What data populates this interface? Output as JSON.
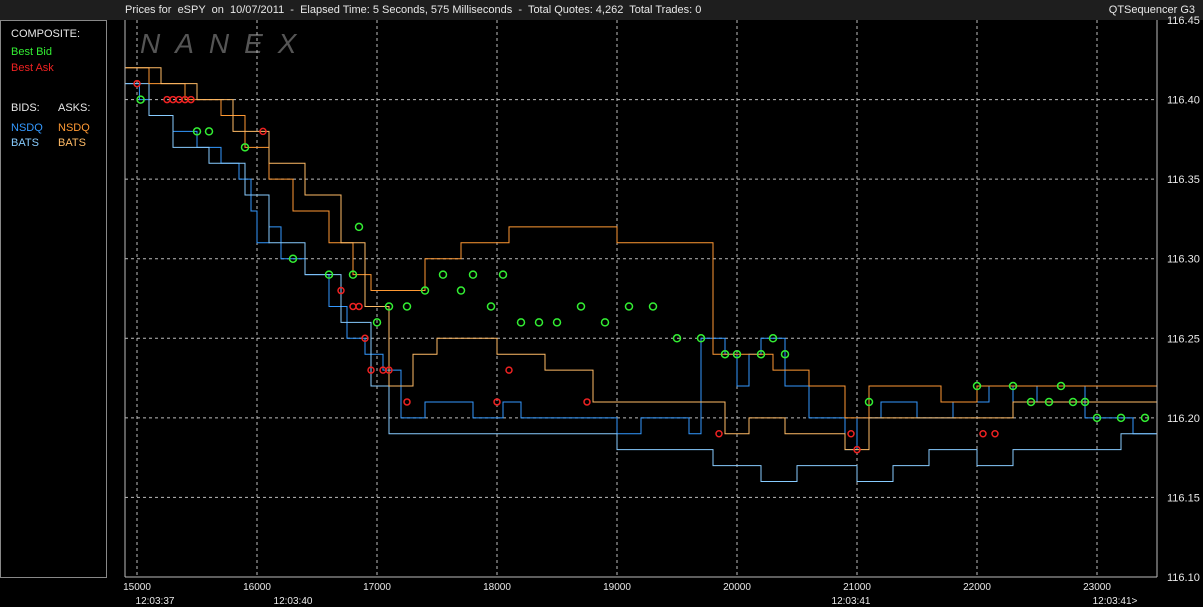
{
  "header": {
    "title": "Prices for  eSPY  on  10/07/2011  -  Elapsed Time: 5 Seconds, 575 Milliseconds  -  Total Quotes: 4,262  Total Trades: 0",
    "app": "QTSequencer G3"
  },
  "watermark": "NANEX",
  "sidebar": {
    "composite_label": "COMPOSITE:",
    "best_bid": "Best Bid",
    "best_ask": "Best Ask",
    "bids_label": "BIDS:",
    "asks_label": "ASKS:",
    "bid_exchanges": [
      "NSDQ",
      "BATS"
    ],
    "ask_exchanges": [
      "NSDQ",
      "BATS"
    ]
  },
  "colors": {
    "best_bid": "#33ee33",
    "best_ask": "#ee2222",
    "nsdq_bid": "#3399ff",
    "bats_bid": "#88ccff",
    "nsdq_ask": "#ff9933",
    "bats_ask": "#ffbb66",
    "grid": "#bbbbbb"
  },
  "chart_data": {
    "type": "line",
    "title": "Prices for eSPY on 10/07/2011",
    "xlim": [
      14900,
      23500
    ],
    "ylim": [
      116.1,
      116.45
    ],
    "x_ticks": [
      15000,
      16000,
      17000,
      18000,
      19000,
      20000,
      21000,
      22000,
      23000
    ],
    "y_ticks": [
      116.1,
      116.15,
      116.2,
      116.25,
      116.3,
      116.35,
      116.4,
      116.45
    ],
    "time_labels": [
      {
        "x": 15150,
        "label": "12:03:37"
      },
      {
        "x": 16300,
        "label": "12:03:40"
      },
      {
        "x": 20950,
        "label": "12:03:41"
      },
      {
        "x": 23150,
        "label": "12:03:41>"
      }
    ],
    "grid": true,
    "series": [
      {
        "name": "NSDQ",
        "side": "bid",
        "x": [
          14900,
          15020,
          15100,
          15300,
          15500,
          15700,
          15850,
          15950,
          16000,
          16100,
          16200,
          16400,
          16600,
          16750,
          16900,
          17050,
          17200,
          17400,
          17800,
          18050,
          18200,
          18500,
          18800,
          19000,
          19200,
          19600,
          19700,
          19900,
          20000,
          20100,
          20200,
          20400,
          20600,
          20800,
          20900,
          21000,
          21200,
          21500,
          21800,
          22100,
          22300,
          22500,
          22700,
          22900,
          23100,
          23300,
          23500
        ],
        "y": [
          116.41,
          116.4,
          116.39,
          116.38,
          116.37,
          116.36,
          116.35,
          116.33,
          116.31,
          116.32,
          116.3,
          116.29,
          116.27,
          116.25,
          116.24,
          116.23,
          116.2,
          116.21,
          116.2,
          116.21,
          116.2,
          116.2,
          116.2,
          116.19,
          116.2,
          116.19,
          116.25,
          116.24,
          116.22,
          116.24,
          116.25,
          116.22,
          116.2,
          116.2,
          116.18,
          116.2,
          116.21,
          116.2,
          116.21,
          116.22,
          116.21,
          116.22,
          116.22,
          116.2,
          116.2,
          116.19,
          116.19
        ]
      },
      {
        "name": "BATS",
        "side": "bid",
        "x": [
          14900,
          15100,
          15300,
          15600,
          15900,
          16100,
          16400,
          16700,
          16950,
          17100,
          17500,
          18000,
          18500,
          19000,
          19500,
          19800,
          20000,
          20200,
          20500,
          20800,
          21000,
          21300,
          21600,
          22000,
          22300,
          22700,
          23000,
          23200,
          23500
        ],
        "y": [
          116.41,
          116.39,
          116.37,
          116.36,
          116.34,
          116.31,
          116.29,
          116.26,
          116.22,
          116.19,
          116.19,
          116.19,
          116.19,
          116.18,
          116.18,
          116.17,
          116.17,
          116.16,
          116.17,
          116.17,
          116.16,
          116.17,
          116.18,
          116.17,
          116.18,
          116.18,
          116.18,
          116.19,
          116.18
        ]
      },
      {
        "name": "NSDQ",
        "side": "ask",
        "x": [
          14900,
          15100,
          15400,
          15700,
          15900,
          16100,
          16300,
          16600,
          16800,
          16950,
          17100,
          17400,
          17700,
          18000,
          18100,
          18500,
          19000,
          19500,
          19800,
          20000,
          20300,
          20600,
          20900,
          21100,
          21400,
          21700,
          22000,
          22400,
          22800,
          23200,
          23500
        ],
        "y": [
          116.42,
          116.41,
          116.4,
          116.39,
          116.37,
          116.35,
          116.33,
          116.31,
          116.29,
          116.28,
          116.28,
          116.3,
          116.31,
          116.31,
          116.32,
          116.32,
          116.31,
          116.31,
          116.24,
          116.24,
          116.23,
          116.22,
          116.2,
          116.22,
          116.22,
          116.21,
          116.22,
          116.22,
          116.22,
          116.22,
          116.22
        ]
      },
      {
        "name": "BATS",
        "side": "ask",
        "x": [
          14900,
          15200,
          15500,
          15800,
          16100,
          16400,
          16700,
          16900,
          17100,
          17300,
          17500,
          17800,
          18000,
          18400,
          18800,
          19200,
          19600,
          19900,
          20100,
          20400,
          20700,
          20900,
          21100,
          21500,
          21900,
          22300,
          22700,
          23100,
          23500
        ],
        "y": [
          116.42,
          116.41,
          116.4,
          116.38,
          116.36,
          116.34,
          116.31,
          116.27,
          116.22,
          116.24,
          116.25,
          116.25,
          116.24,
          116.23,
          116.21,
          116.21,
          116.21,
          116.19,
          116.2,
          116.19,
          116.19,
          116.18,
          116.2,
          116.2,
          116.2,
          116.21,
          116.21,
          116.21,
          116.21
        ]
      }
    ],
    "best_bid_points": {
      "x": [
        15030,
        15500,
        15600,
        15900,
        16300,
        16600,
        16800,
        16850,
        17000,
        17100,
        17250,
        17400,
        17550,
        17700,
        17800,
        17950,
        18050,
        18200,
        18350,
        18500,
        18700,
        18900,
        19100,
        19300,
        19500,
        19700,
        19900,
        20000,
        20200,
        20300,
        20400,
        21100,
        22000,
        22300,
        22450,
        22600,
        22700,
        22800,
        22900,
        23000,
        23200,
        23400
      ],
      "y": [
        116.4,
        116.38,
        116.38,
        116.37,
        116.3,
        116.29,
        116.29,
        116.32,
        116.26,
        116.27,
        116.27,
        116.28,
        116.29,
        116.28,
        116.29,
        116.27,
        116.29,
        116.26,
        116.26,
        116.26,
        116.27,
        116.26,
        116.27,
        116.27,
        116.25,
        116.25,
        116.24,
        116.24,
        116.24,
        116.25,
        116.24,
        116.21,
        116.22,
        116.22,
        116.21,
        116.21,
        116.22,
        116.21,
        116.21,
        116.2,
        116.2,
        116.2
      ]
    },
    "best_ask_points": {
      "x": [
        15000,
        15250,
        15300,
        15350,
        15400,
        15450,
        16050,
        16700,
        16800,
        16850,
        16900,
        16950,
        17050,
        17100,
        17250,
        18000,
        18100,
        18750,
        19850,
        20950,
        21000,
        22050,
        22150
      ],
      "y": [
        116.41,
        116.4,
        116.4,
        116.4,
        116.4,
        116.4,
        116.38,
        116.28,
        116.27,
        116.27,
        116.25,
        116.23,
        116.23,
        116.23,
        116.21,
        116.21,
        116.23,
        116.21,
        116.19,
        116.19,
        116.18,
        116.19,
        116.19
      ]
    }
  }
}
